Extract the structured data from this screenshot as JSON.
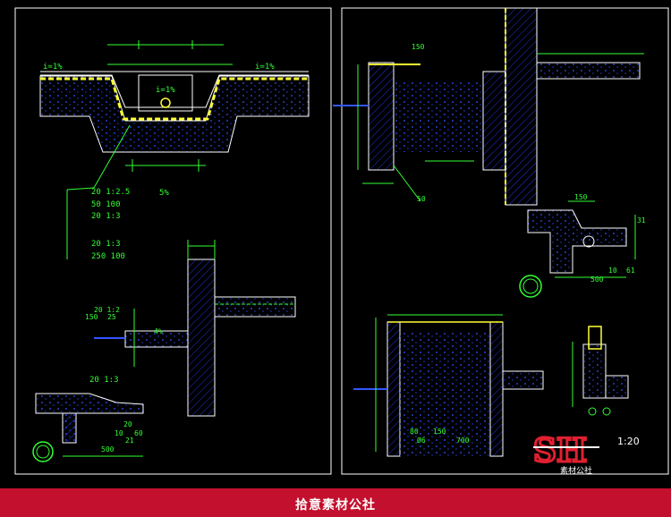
{
  "left_panel": {
    "slope_left": "i=1%",
    "slope_right": "i=1%",
    "slope_center": "i=1%",
    "pct_label": "5%",
    "layers": [
      "20  1:2.5",
      "50  100",
      "20  1:3",
      "20  1:3",
      "250  100"
    ],
    "small_dims_top": [
      "20  1:2",
      "150",
      "25"
    ],
    "wall_slope": "4%",
    "cap_dim": "20  1:3",
    "dim_500": "500",
    "dim_20": "20",
    "dim_10": "10",
    "dim_60": "60",
    "dim_21": "21"
  },
  "right_panel": {
    "dim_150_top": "150",
    "dim_50": "50",
    "detail_dim_150": "150",
    "detail_dim_500": "500",
    "detail_dim_61": "61",
    "detail_dim_10": "10",
    "detail_dim_31": "31",
    "bottom_dim_80": "80",
    "bottom_dim_150": "150",
    "bottom_dim_700": "700",
    "bottom_phi": "Ø6"
  },
  "logo": {
    "text": "SH",
    "subtitle": "素材公社",
    "scale": "1:20"
  },
  "footer": {
    "text": "拾意素材公社"
  },
  "colors": {
    "background": "#000000",
    "frame": "#ffffff",
    "dims": "#33ff33",
    "yellow": "#ffff33",
    "hatch": "#3344ff",
    "footer": "#c3102e"
  }
}
